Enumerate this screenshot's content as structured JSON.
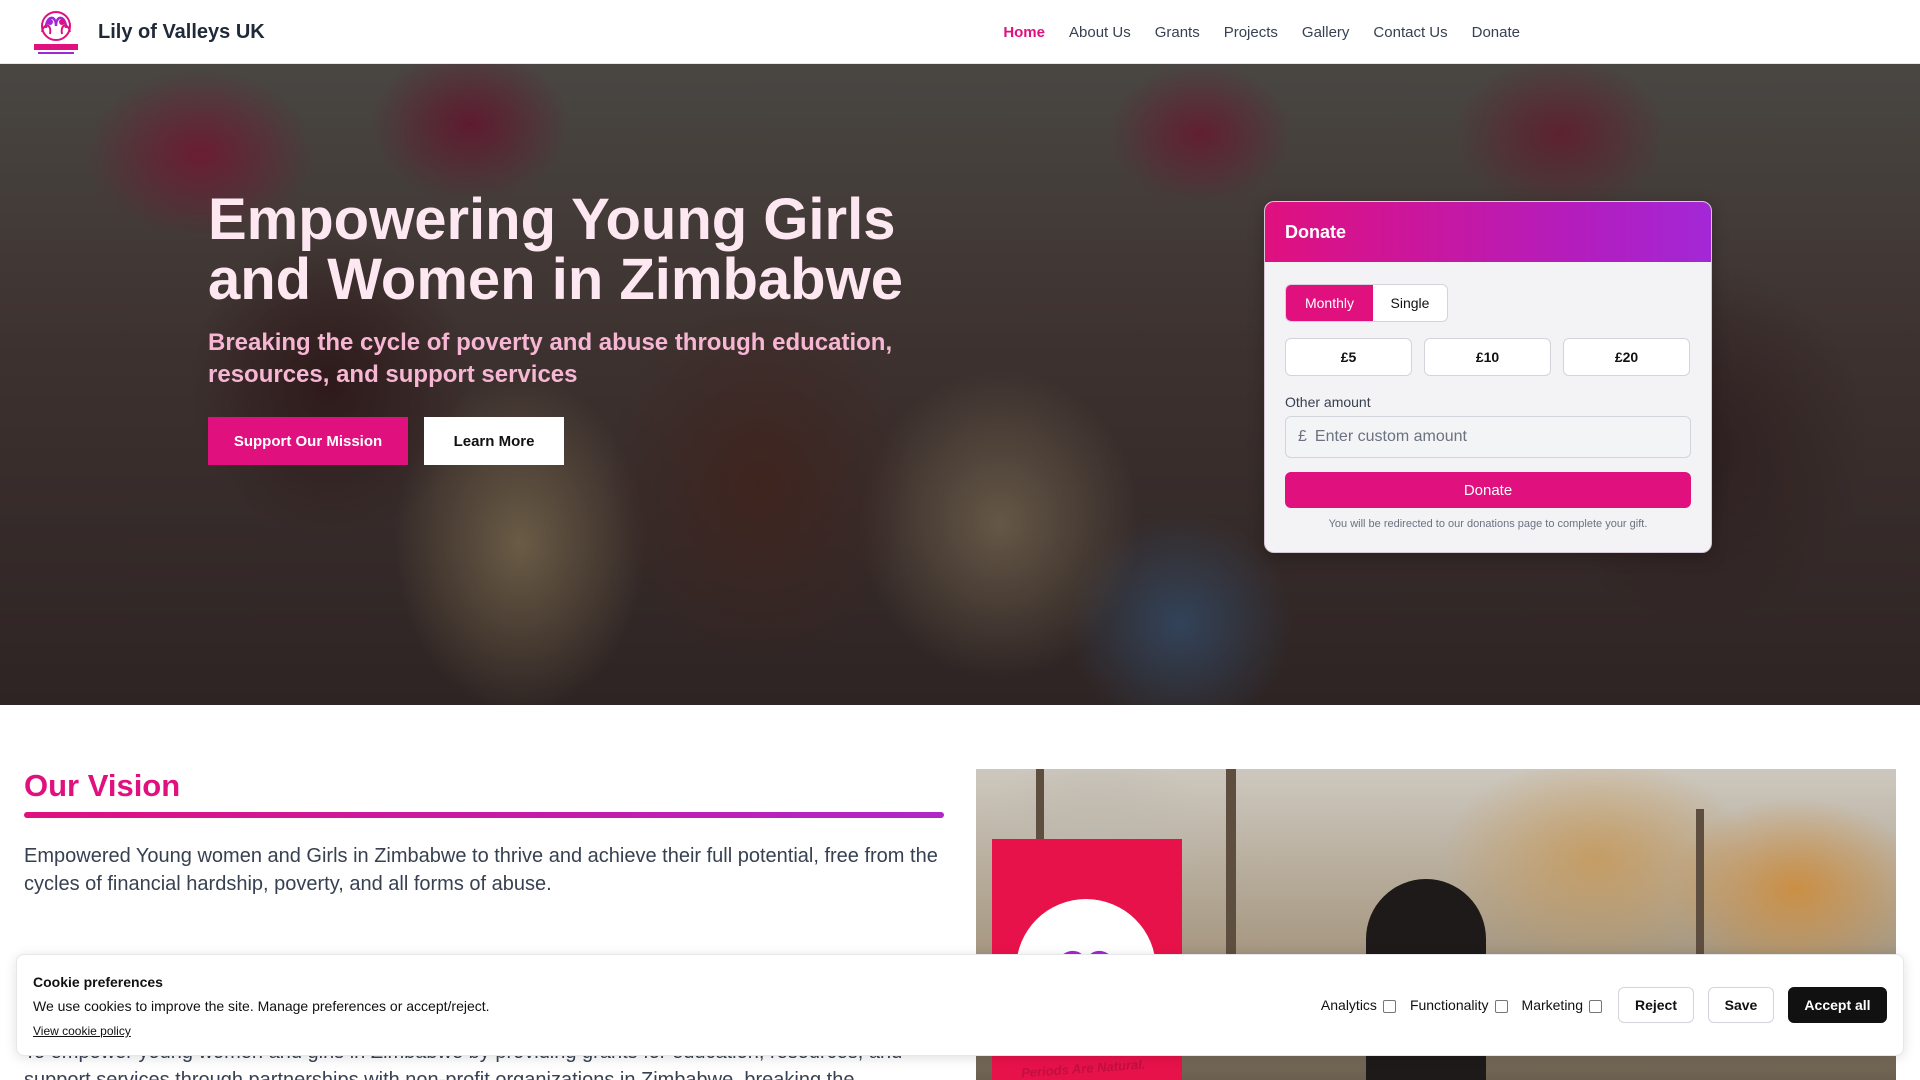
{
  "brand": {
    "name": "Lily of Valleys UK",
    "logo_icon": "lily-of-valleys-logo-icon"
  },
  "nav": {
    "items": [
      {
        "label": "Home",
        "active": true
      },
      {
        "label": "About Us"
      },
      {
        "label": "Grants"
      },
      {
        "label": "Projects"
      },
      {
        "label": "Gallery"
      },
      {
        "label": "Contact Us"
      },
      {
        "label": "Donate"
      }
    ]
  },
  "hero": {
    "title": "Empowering Young Girls and Women in Zimbabwe",
    "subtitle": "Breaking the cycle of poverty and abuse through education, resources, and support services",
    "primary_button": "Support Our Mission",
    "secondary_button": "Learn More"
  },
  "donate": {
    "title": "Donate",
    "frequency": {
      "monthly": "Monthly",
      "single": "Single",
      "selected": "Monthly"
    },
    "amounts": [
      "£5",
      "£10",
      "£20"
    ],
    "other_label": "Other amount",
    "currency_symbol": "£",
    "other_placeholder": "Enter custom amount",
    "button": "Donate",
    "note": "You will be redirected to our donations page to complete your gift."
  },
  "vision": {
    "title": "Our Vision",
    "text": "Empowered Young women and Girls in Zimbabwe to thrive and achieve their full potential, free from the cycles of financial hardship, poverty, and all forms of abuse.",
    "mission_text": "To empower young women and girls in Zimbabwe by providing grants for education, resources, and support services through partnerships with non-profit organizations in Zimbabwe, breaking the",
    "photo_banner_text": "Periods Are Natural."
  },
  "cookie": {
    "title": "Cookie preferences",
    "text": "We use cookies to improve the site. Manage preferences or accept/reject.",
    "link": "View cookie policy",
    "analytics": "Analytics",
    "functionality": "Functionality",
    "marketing": "Marketing",
    "reject": "Reject",
    "save": "Save",
    "accept": "Accept all"
  },
  "colors": {
    "accent": "#e0107e",
    "accent_purple": "#a327d6",
    "dark": "#111111"
  }
}
